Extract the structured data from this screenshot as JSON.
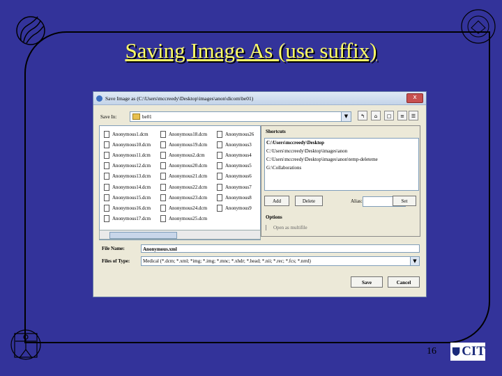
{
  "slide": {
    "title": "Saving Image As (use suffix)",
    "page_number": "16",
    "cit_logo_text": "CIT"
  },
  "dialog": {
    "title": "Save Image as (C:\\Users\\mccreedy\\Desktop\\images\\anon\\dicom\\be01)",
    "close_glyph": "x",
    "save_in_label": "Save In:",
    "save_in_value": "be01",
    "toolbar": [
      "up-folder-icon",
      "home-icon",
      "new-folder-icon",
      "list-view-icon",
      "details-view-icon"
    ],
    "files": [
      [
        "Anonymous1.dcm",
        "Anonymous10.dcm",
        "Anonymous11.dcm",
        "Anonymous12.dcm",
        "Anonymous13.dcm",
        "Anonymous14.dcm",
        "Anonymous15.dcm",
        "Anonymous16.dcm",
        "Anonymous17.dcm"
      ],
      [
        "Anonymous18.dcm",
        "Anonymous19.dcm",
        "Anonymous2.dcm",
        "Anonymous20.dcm",
        "Anonymous21.dcm",
        "Anonymous22.dcm",
        "Anonymous23.dcm",
        "Anonymous24.dcm",
        "Anonymous25.dcm"
      ],
      [
        "Anonymous26",
        "Anonymous3",
        "Anonymous4",
        "Anonymous5",
        "Anonymous6",
        "Anonymous7",
        "Anonymous8",
        "Anonymous9",
        ""
      ]
    ],
    "shortcuts": {
      "heading": "Shortcuts",
      "items": [
        "C:\\Users\\mccreedy\\Desktop",
        "C:\\Users\\mccreedy\\Desktop\\images\\anon",
        "C:\\Users\\mccreedy\\Desktop\\images\\anon\\temp-deleteme",
        "G:\\Collaborations"
      ],
      "add_label": "Add",
      "delete_label": "Delete",
      "alias_label": "Alias:",
      "alias_value": "",
      "set_label": "Set",
      "options_heading": "Options",
      "open_multifile_label": "Open as multifile"
    },
    "file_name_label": "File Name:",
    "file_name_value": "Anonymous.xml",
    "file_type_label": "Files of Type:",
    "file_type_value": "Medical (*.dcm; *.xml; *img; *.img; *.mnc; *.xhdr; *.head; *.nii; *.rec; *.fcs; *.nrrd)",
    "save_label": "Save",
    "cancel_label": "Cancel"
  },
  "colors": {
    "slide_background": "#33339a",
    "title_color": "#ffff66",
    "dialog_background": "#ece9d8"
  }
}
